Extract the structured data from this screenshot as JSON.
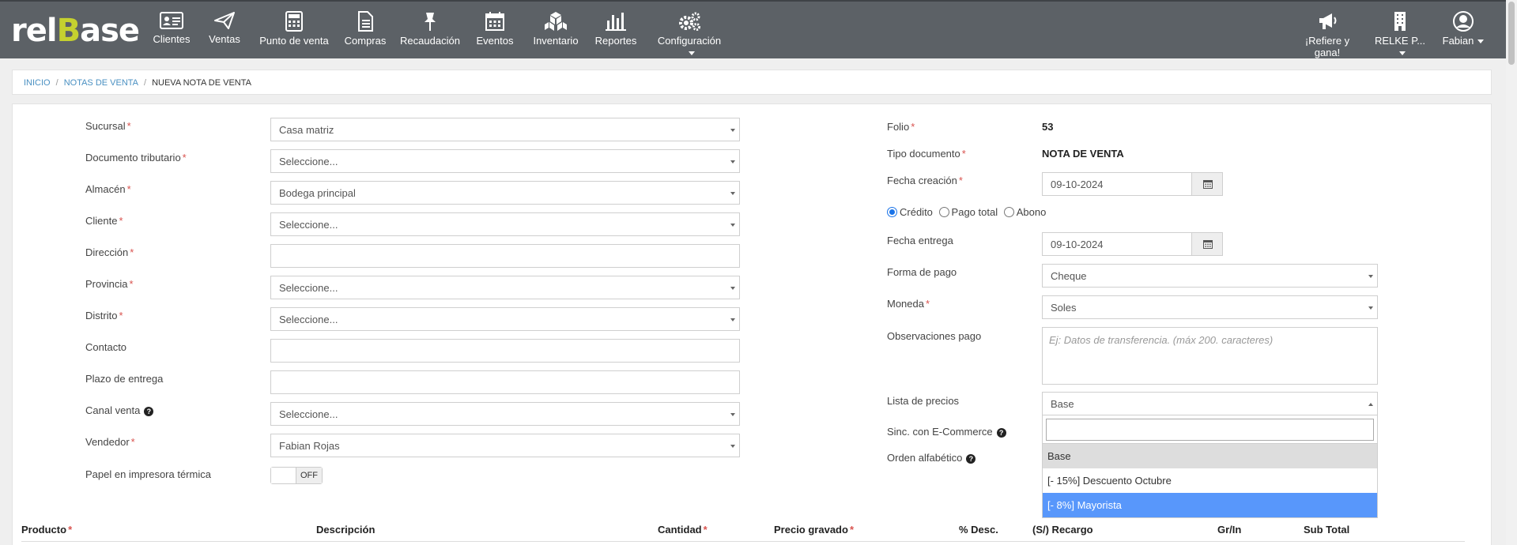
{
  "brand": {
    "logo_left": "rel",
    "logo_accent": "B",
    "logo_right": "ase",
    "accent_color": "#c5d12f"
  },
  "nav": {
    "clientes": "Clientes",
    "ventas": "Ventas",
    "punto_venta": "Punto de venta",
    "compras": "Compras",
    "recaudacion": "Recaudación",
    "eventos": "Eventos",
    "inventario": "Inventario",
    "reportes": "Reportes",
    "configuracion": "Configuración",
    "refiere": "¡Refiere y gana!",
    "empresa": "RELKE P...",
    "usuario": "Fabian"
  },
  "breadcrumb": {
    "inicio": "INICIO",
    "notas": "NOTAS DE VENTA",
    "current": "NUEVA NOTA DE VENTA"
  },
  "form_left": {
    "sucursal": {
      "label": "Sucursal",
      "value": "Casa matriz"
    },
    "documento": {
      "label": "Documento tributario",
      "value": "Seleccione..."
    },
    "almacen": {
      "label": "Almacén",
      "value": "Bodega principal"
    },
    "cliente": {
      "label": "Cliente",
      "value": "Seleccione..."
    },
    "direccion": {
      "label": "Dirección",
      "value": ""
    },
    "provincia": {
      "label": "Provincia",
      "value": "Seleccione..."
    },
    "distrito": {
      "label": "Distrito",
      "value": "Seleccione..."
    },
    "contacto": {
      "label": "Contacto",
      "value": ""
    },
    "plazo": {
      "label": "Plazo de entrega",
      "value": ""
    },
    "canal": {
      "label": "Canal venta",
      "value": "Seleccione..."
    },
    "vendedor": {
      "label": "Vendedor",
      "value": "Fabian Rojas"
    },
    "papel": {
      "label": "Papel en impresora térmica",
      "toggle": "OFF"
    }
  },
  "form_right": {
    "folio": {
      "label": "Folio",
      "value": "53"
    },
    "tipo": {
      "label": "Tipo documento",
      "value": "NOTA DE VENTA"
    },
    "fecha_creacion": {
      "label": "Fecha creación",
      "value": "09-10-2024"
    },
    "radios": {
      "credito": "Crédito",
      "pago_total": "Pago total",
      "abono": "Abono",
      "selected": "credito"
    },
    "fecha_entrega": {
      "label": "Fecha entrega",
      "value": "09-10-2024"
    },
    "forma_pago": {
      "label": "Forma de pago",
      "value": "Cheque"
    },
    "moneda": {
      "label": "Moneda",
      "value": "Soles"
    },
    "observaciones": {
      "label": "Observaciones pago",
      "placeholder": "Ej: Datos de transferencia. (máx 200. caracteres)"
    },
    "lista_precios": {
      "label": "Lista de precios",
      "value": "Base"
    },
    "sinc": {
      "label": "Sinc. con E-Commerce"
    },
    "orden": {
      "label": "Orden alfabético"
    }
  },
  "dropdown": {
    "options": [
      "Base",
      "[- 15%] Descuento Octubre",
      "[- 8%] Mayorista"
    ],
    "selected_index": 0,
    "hover_index": 2,
    "hover_color": "#5897fb"
  },
  "table_header": {
    "producto": "Producto",
    "descripcion": "Descripción",
    "cantidad": "Cantidad",
    "precio": "Precio gravado",
    "desc": "% Desc.",
    "recargo": "(S/) Recargo",
    "grin": "Gr/In",
    "subtotal": "Sub Total"
  },
  "required_mark": "*"
}
